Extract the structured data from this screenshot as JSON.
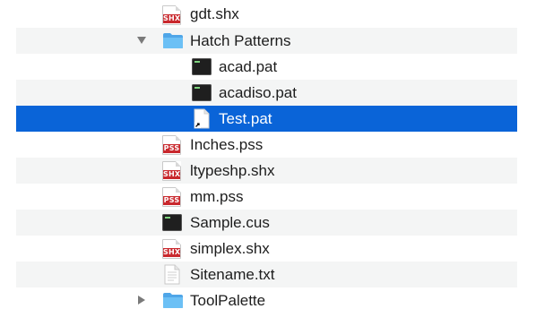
{
  "colors": {
    "selection": "#0a64d8",
    "row_alt": "#f4f5f5",
    "folder": "#5fb3ee"
  },
  "rows": [
    {
      "label": "gdt.shx",
      "icon": "shx-file-icon",
      "badge": "SHX"
    },
    {
      "label": "Hatch Patterns",
      "icon": "folder-icon",
      "disclosure": "expanded"
    },
    {
      "label": "acad.pat",
      "icon": "terminal-file-icon"
    },
    {
      "label": "acadiso.pat",
      "icon": "terminal-file-icon"
    },
    {
      "label": "Test.pat",
      "icon": "alias-document-icon",
      "selected": true
    },
    {
      "label": "Inches.pss",
      "icon": "pss-file-icon",
      "badge": "PSS"
    },
    {
      "label": "ltypeshp.shx",
      "icon": "shx-file-icon",
      "badge": "SHX"
    },
    {
      "label": "mm.pss",
      "icon": "pss-file-icon",
      "badge": "PSS"
    },
    {
      "label": "Sample.cus",
      "icon": "terminal-file-icon"
    },
    {
      "label": "simplex.shx",
      "icon": "shx-file-icon",
      "badge": "SHX"
    },
    {
      "label": "Sitename.txt",
      "icon": "text-document-icon"
    },
    {
      "label": "ToolPalette",
      "icon": "folder-icon",
      "disclosure": "collapsed"
    }
  ]
}
